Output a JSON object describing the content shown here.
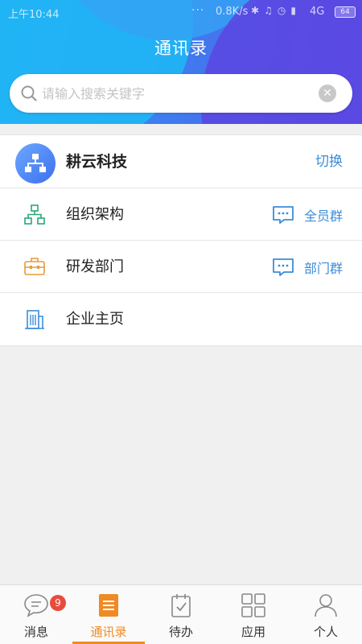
{
  "status_bar": {
    "time": "上午10:44",
    "dots": "···",
    "speed": "0.8K/s",
    "network": "4G",
    "battery": "64"
  },
  "header": {
    "title": "通讯录"
  },
  "search": {
    "placeholder": "请输入搜索关键字"
  },
  "company": {
    "name": "耕云科技",
    "switch_label": "切换"
  },
  "menu": [
    {
      "label": "组织架构",
      "group_label": "全员群",
      "icon": "org-chart-icon"
    },
    {
      "label": "研发部门",
      "group_label": "部门群",
      "icon": "briefcase-icon"
    },
    {
      "label": "企业主页",
      "icon": "building-icon"
    }
  ],
  "tabs": [
    {
      "label": "消息",
      "badge": "9",
      "icon": "chat-icon"
    },
    {
      "label": "通讯录",
      "icon": "contacts-icon",
      "active": true
    },
    {
      "label": "待办",
      "icon": "todo-icon"
    },
    {
      "label": "应用",
      "icon": "apps-grid-icon"
    },
    {
      "label": "个人",
      "icon": "person-icon"
    }
  ],
  "colors": {
    "accent_blue": "#3b8ddb",
    "accent_orange": "#f08a24",
    "badge_red": "#e84c3d"
  }
}
